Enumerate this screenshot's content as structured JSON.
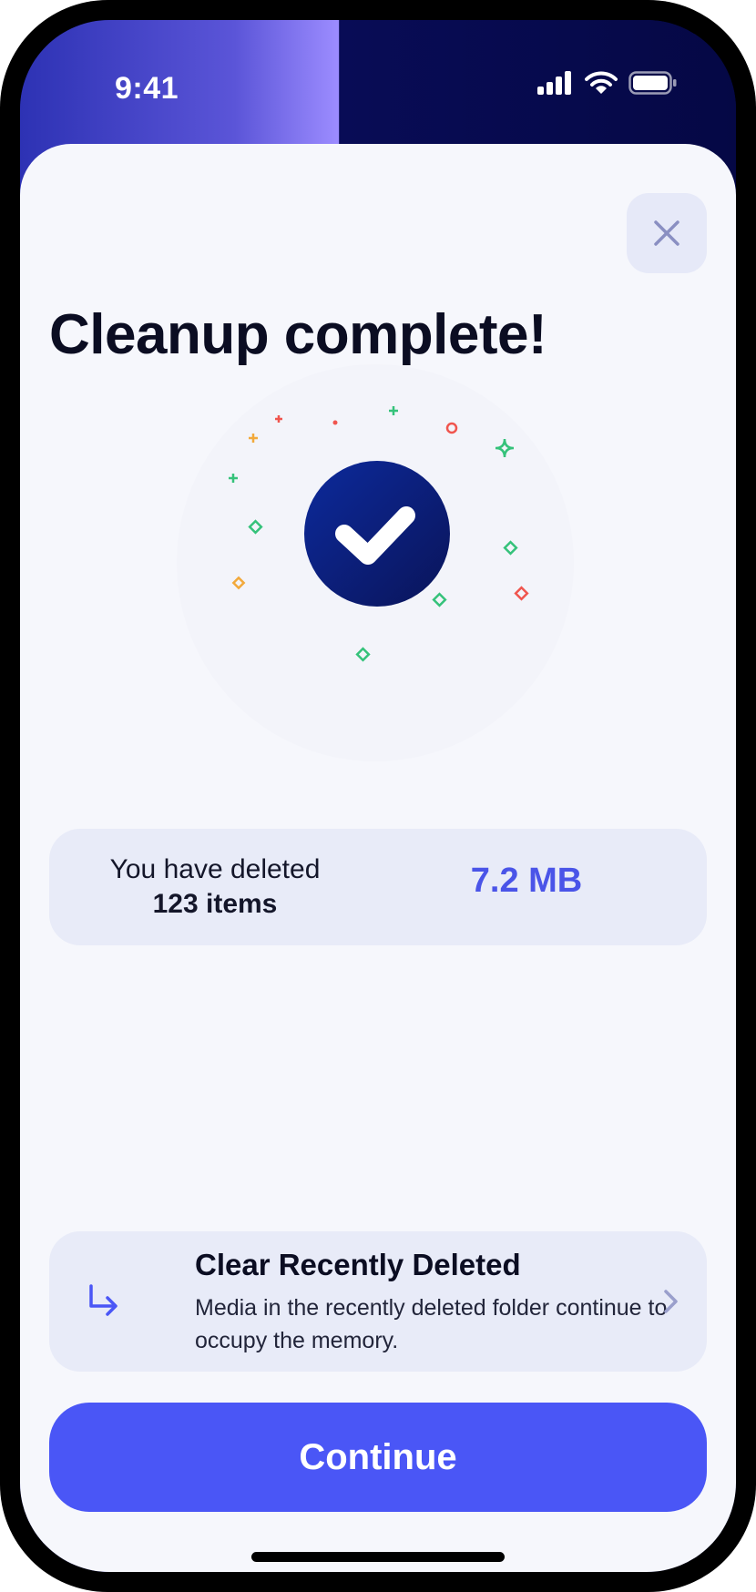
{
  "status_bar": {
    "time": "9:41",
    "icons": [
      "signal-icon",
      "wifi-icon",
      "battery-icon"
    ]
  },
  "header": {
    "close_icon": "close-icon",
    "title": "Cleanup complete!"
  },
  "illustration": {
    "icon": "checkmark-icon",
    "colors": {
      "circle": "#0b1d7a",
      "confetti_green": "#35c27a",
      "confetti_red": "#f0554e",
      "confetti_orange": "#f2a93b"
    }
  },
  "stats": {
    "line1": "You have deleted",
    "count": "123 items",
    "size": "7.2 MB"
  },
  "recently_deleted": {
    "icon": "arrow-turn-down-right-icon",
    "title": "Clear Recently Deleted",
    "description": "Media in the recently deleted folder continue to occupy the memory.",
    "chevron_icon": "chevron-right-icon"
  },
  "actions": {
    "continue_label": "Continue"
  },
  "colors": {
    "accent": "#4a56f6",
    "sheet_bg": "#f6f7fc",
    "card_bg": "#e8ebf8",
    "size_text": "#4a54e8"
  }
}
